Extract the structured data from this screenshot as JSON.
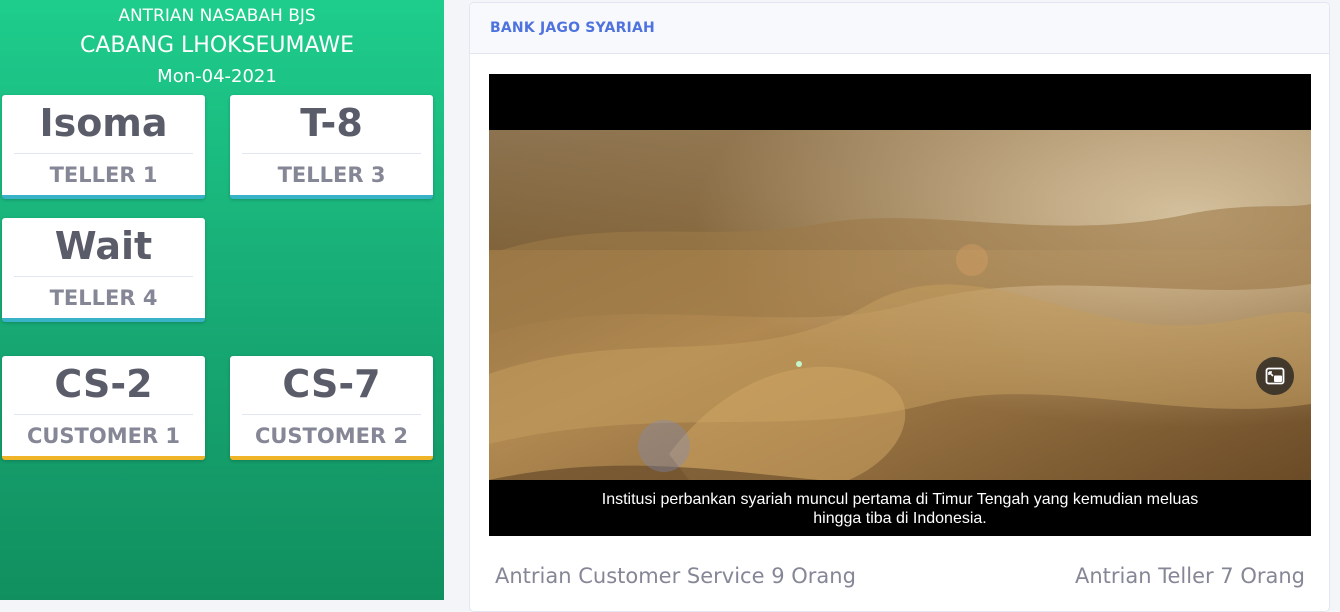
{
  "header": {
    "line1": "ANTRIAN NASABAH BJS",
    "line2": "CABANG LHOKSEUMAWE",
    "date": "Mon-04-2021"
  },
  "counters": [
    {
      "number": "Isoma",
      "label": "TELLER 1"
    },
    {
      "number": "T-8",
      "label": "TELLER 3"
    },
    {
      "number": "Wait",
      "label": "TELLER 4"
    },
    {
      "number": "CS-2",
      "label": "CUSTOMER 1"
    },
    {
      "number": "CS-7",
      "label": "CUSTOMER 2"
    }
  ],
  "panel": {
    "title": "BANK JAGO SYARIAH",
    "video": {
      "caption_line1": "Institusi perbankan syariah muncul pertama di Timur Tengah yang kemudian meluas",
      "caption_line2": "hingga tiba di Indonesia.",
      "pip_icon": "picture-in-picture-icon"
    },
    "footer_left": "Antrian Customer Service 9 Orang",
    "footer_right": "Antrian Teller 7 Orang"
  },
  "colors": {
    "green_top": "#1ecd8c",
    "green_bottom": "#118f5f",
    "teal_accent": "#38b2c7",
    "gold_accent": "#f0b429",
    "title_blue": "#4e73df",
    "gray_text": "#858796"
  }
}
